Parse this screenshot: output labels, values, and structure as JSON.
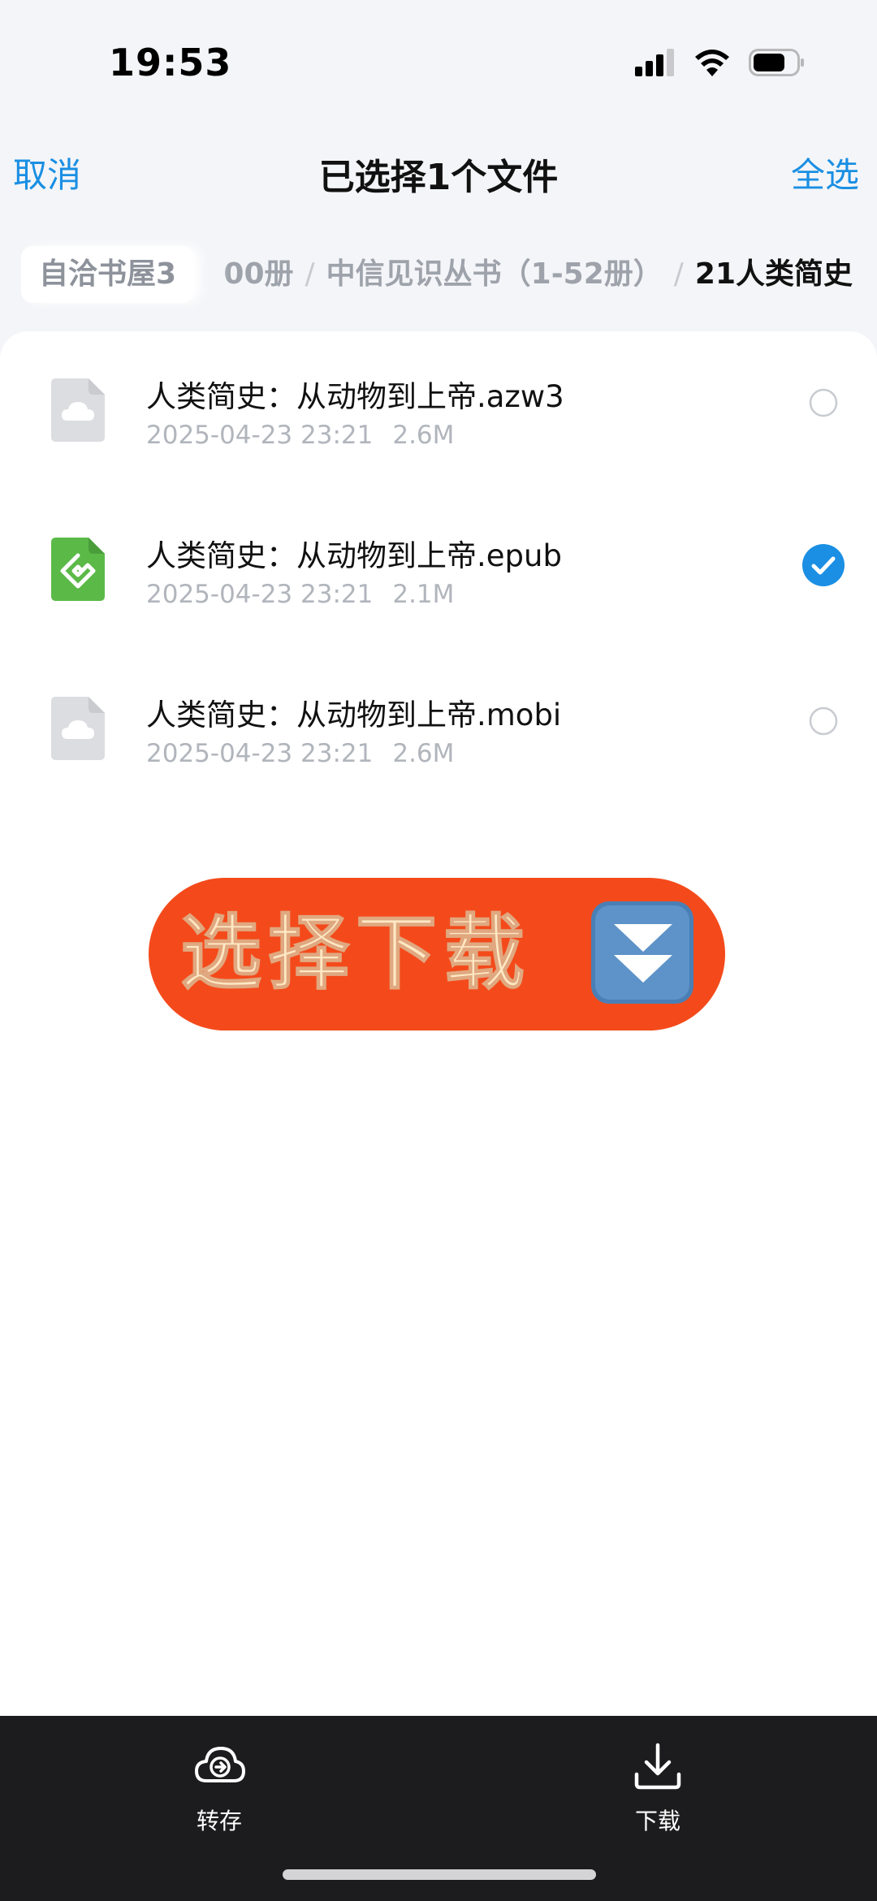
{
  "status_bar": {
    "time": "19:53"
  },
  "nav": {
    "cancel_label": "取消",
    "title": "已选择1个文件",
    "select_all_label": "全选"
  },
  "breadcrumb": {
    "root": "自洽书屋3",
    "trail": [
      "00册",
      "中信见识丛书（1-52册）",
      "21人类简史"
    ]
  },
  "files": [
    {
      "name": "人类简史：从动物到上帝.azw3",
      "date": "2025-04-23 23:21",
      "size": "2.6M",
      "type": "cloud-file-icon",
      "selected": false
    },
    {
      "name": "人类简史：从动物到上帝.epub",
      "date": "2025-04-23 23:21",
      "size": "2.1M",
      "type": "epub-file-icon",
      "selected": true
    },
    {
      "name": "人类简史：从动物到上帝.mobi",
      "date": "2025-04-23 23:21",
      "size": "2.6M",
      "type": "cloud-file-icon",
      "selected": false
    }
  ],
  "promo": {
    "text": "选择下载",
    "icon": "double-down-arrow-icon"
  },
  "bottom_bar": {
    "save_label": "转存",
    "download_label": "下载"
  },
  "colors": {
    "accent": "#1a8fe3",
    "epub_green": "#5bb948",
    "promo_red": "#f44a1b",
    "promo_text": "#fde8c4",
    "bottom_bar": "#1c1c1e"
  }
}
